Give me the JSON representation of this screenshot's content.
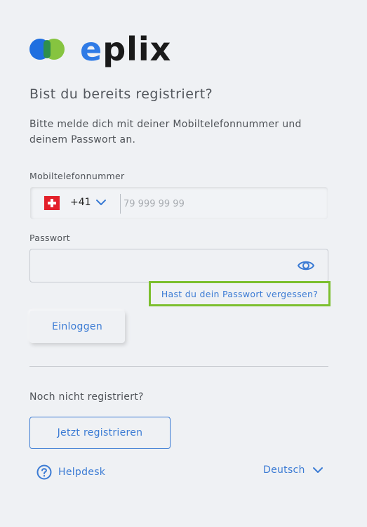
{
  "logo": {
    "text_accent": "e",
    "text_rest": "plix"
  },
  "heading": "Bist du bereits registriert?",
  "intro": "Bitte melde dich mit deiner Mobiltelefonnummer und deinem Passwort an.",
  "phone": {
    "label": "Mobiltelefonnummer",
    "country_code": "+41",
    "placeholder": "79 999 99 99",
    "value": ""
  },
  "password": {
    "label": "Passwort",
    "value": "",
    "visibility_icon": "eye-icon"
  },
  "forgot_password": "Hast du dein Passwort vergessen?",
  "login_button": "Einloggen",
  "register": {
    "prompt": "Noch nicht registriert?",
    "button": "Jetzt registrieren"
  },
  "footer": {
    "helpdesk": "Helpdesk",
    "language": "Deutsch"
  },
  "colors": {
    "accent": "#3b7bd4",
    "highlight": "#7cbf2e",
    "background": "#eff1f4"
  }
}
